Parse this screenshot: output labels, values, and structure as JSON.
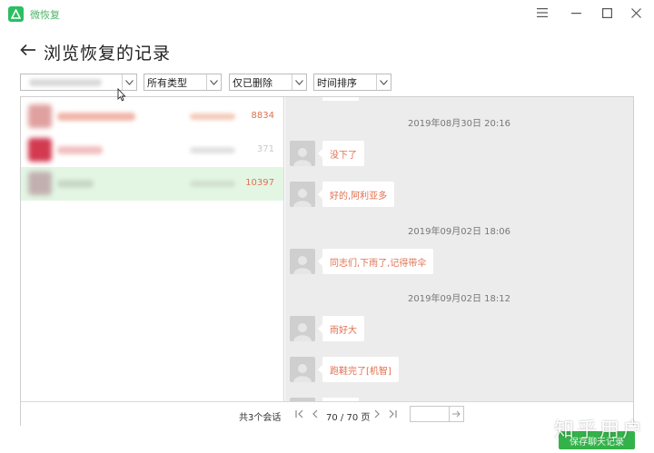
{
  "app": {
    "title": "微恢复",
    "accent_color": "#2bbf61",
    "logo_icon": "app-logo-icon"
  },
  "window_controls": {
    "menu_icon": "hamburger-menu-icon",
    "minimize_icon": "minimize-icon",
    "maximize_icon": "maximize-icon",
    "close_icon": "close-icon"
  },
  "header": {
    "back_icon": "arrow-left-icon",
    "title": "浏览恢复的记录"
  },
  "filters": {
    "contact_select": "",
    "type_select": "所有类型",
    "deleted_select": "仅已删除",
    "sort_select": "时间排序"
  },
  "conversations": [
    {
      "count": "8834",
      "selected": false,
      "avatar_color": "#e0a0a0",
      "name_color": "#f0b6a8"
    },
    {
      "count": "371",
      "selected": false,
      "avatar_color": "#d23a50",
      "name_color": "#f2c0c0"
    },
    {
      "count": "10397",
      "selected": true,
      "avatar_color": "#c2b0b0",
      "name_color": "#c8d8c6"
    }
  ],
  "messages": [
    {
      "kind": "time",
      "text": "2019年08月30日 20:16"
    },
    {
      "kind": "msg",
      "text": "没下了"
    },
    {
      "kind": "msg",
      "text": "好的,阿利亚多"
    },
    {
      "kind": "time",
      "text": "2019年09月02日 18:06"
    },
    {
      "kind": "msg",
      "text": "同志们,下雨了,记得带伞"
    },
    {
      "kind": "time",
      "text": "2019年09月02日 18:12"
    },
    {
      "kind": "msg",
      "text": "雨好大"
    },
    {
      "kind": "msg",
      "text": "跑鞋完了[机智]"
    }
  ],
  "footer": {
    "conversation_total": "共3个会话",
    "page_info": "70 / 70 页",
    "page_input_value": "",
    "first_icon": "first-page-icon",
    "prev_icon": "prev-page-icon",
    "next_icon": "next-page-icon",
    "last_icon": "last-page-icon",
    "go_icon": "go-arrow-icon"
  },
  "actions": {
    "save_label": "保存聊天记录"
  },
  "watermark": "知乎用户"
}
